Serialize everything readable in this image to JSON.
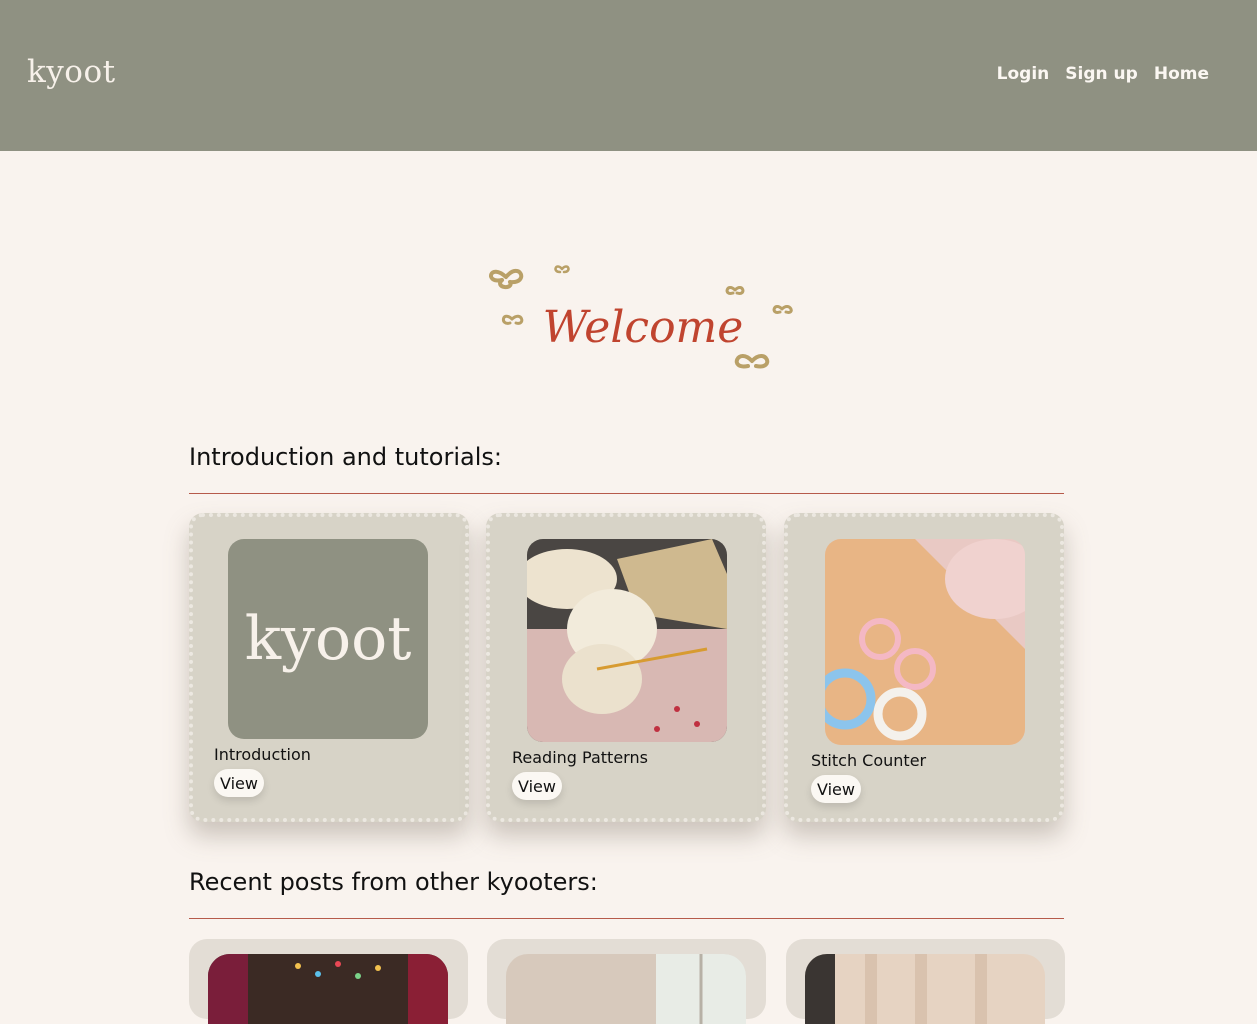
{
  "header": {
    "brand": "kyoot",
    "nav": [
      {
        "label": "Login"
      },
      {
        "label": "Sign up"
      },
      {
        "label": "Home"
      }
    ]
  },
  "welcome": {
    "text": "Welcome"
  },
  "sections": {
    "intro_title": "Introduction and tutorials:",
    "recent_title": "Recent posts from other kyooters:"
  },
  "tutorials": [
    {
      "label": "Introduction",
      "button": "View",
      "image": "kyoot-logo",
      "logo_text": "kyoot"
    },
    {
      "label": "Reading Patterns",
      "button": "View",
      "image": "knitting-photo"
    },
    {
      "label": "Stitch Counter",
      "button": "View",
      "image": "stitch-markers-photo"
    }
  ],
  "recent_posts": [
    {
      "image": "christmas-lights-photo"
    },
    {
      "image": "window-photo"
    },
    {
      "image": "curtain-photo"
    }
  ],
  "colors": {
    "header_bg": "#8f9182",
    "page_bg": "#f9f3ee",
    "card_bg": "#d7d3c7",
    "accent_red": "#b65a4a",
    "welcome_red": "#c0442f",
    "bow_gold": "#b9a067"
  }
}
